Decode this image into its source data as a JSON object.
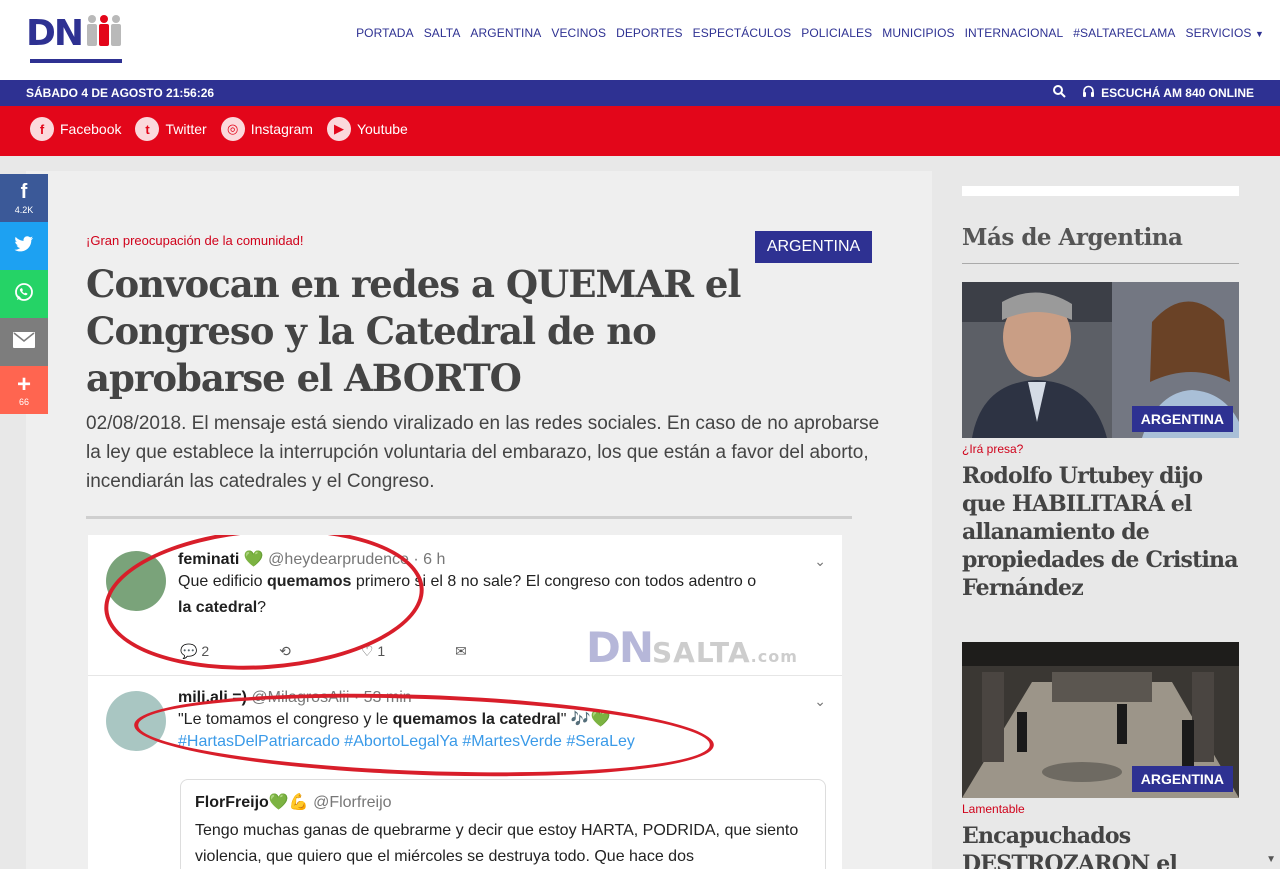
{
  "header": {
    "logo_text": "DN",
    "nav": [
      "PORTADA",
      "SALTA",
      "ARGENTINA",
      "VECINOS",
      "DEPORTES",
      "ESPECTÁCULOS",
      "POLICIALES",
      "MUNICIPIOS",
      "INTERNACIONAL",
      "#SALTARECLAMA",
      "SERVICIOS"
    ],
    "date": "SÁBADO 4 DE AGOSTO 21:56:26",
    "radio": "ESCUCHÁ AM 840 ONLINE"
  },
  "socials": [
    {
      "label": "Facebook",
      "icon": "facebook-icon",
      "glyph": "f"
    },
    {
      "label": "Twitter",
      "icon": "twitter-icon",
      "glyph": "t"
    },
    {
      "label": "Instagram",
      "icon": "instagram-icon",
      "glyph": "◎"
    },
    {
      "label": "Youtube",
      "icon": "youtube-icon",
      "glyph": "▶"
    }
  ],
  "share": [
    {
      "icon": "facebook-icon",
      "glyph": "f",
      "count": "4.2K",
      "color": "#3b5998"
    },
    {
      "icon": "twitter-icon",
      "glyph": "🐦",
      "count": "",
      "color": "#1da1f2"
    },
    {
      "icon": "whatsapp-icon",
      "glyph": "☏",
      "count": "",
      "color": "#25d366"
    },
    {
      "icon": "email-icon",
      "glyph": "✉",
      "count": "",
      "color": "#7d7d7d"
    },
    {
      "icon": "plus-icon",
      "glyph": "+",
      "count": "66",
      "color": "#ff6550"
    }
  ],
  "article": {
    "kicker": "¡Gran preocupación de la comunidad!",
    "category": "ARGENTINA",
    "headline": "Convocan en redes a QUEMAR el Congreso y la Catedral de no aprobarse el ABORTO",
    "lead": "02/08/2018. El mensaje está siendo viralizado en las redes sociales. En caso de no aprobarse la ley que establece la interrupción voluntaria del embarazo, los que están a favor del aborto, incendiarán las catedrales y el Congreso."
  },
  "tweets": {
    "t1_name": "feminati 💚",
    "t1_handle": "@heydearprudence · 6 h",
    "t1_text_a": "Que edificio ",
    "t1_text_b": "quemamos",
    "t1_text_c": " primero si el 8 no sale? El congreso con todos adentro o",
    "t1_text_d": "la catedral",
    "t1_text_e": "?",
    "t1_replies": "2",
    "t1_likes": "1",
    "t2_name": "mili.ali =)",
    "t2_handle": "@MilagrosAlii · 53 min",
    "t2_text_a": "\"Le tomamos el congreso y le ",
    "t2_text_b": "quemamos la catedral",
    "t2_text_c": "\" 🎶💚",
    "t2_hashtags": "#HartasDelPatriarcado #AbortoLegalYa #MartesVerde #SeraLey",
    "q_name": "FlorFreijo💚💪",
    "q_handle": "@Florfreijo",
    "q_text": "Tengo muchas ganas de quebrarme y decir que estoy HARTA, PODRIDA, que siento violencia, que quiero que el miércoles se destruya todo. Que hace dos",
    "watermark_a": "DN",
    "watermark_b": "SALTA",
    "watermark_c": ".com"
  },
  "sidebar": {
    "title": "Más de Argentina",
    "cards": [
      {
        "badge": "ARGENTINA",
        "kicker": "¿Irá presa?",
        "title": "Rodolfo Urtubey dijo que HABILITARÁ el allanamiento de propiedades de Cristina Fernández"
      },
      {
        "badge": "ARGENTINA",
        "kicker": "Lamentable",
        "title": "Encapuchados DESTROZARON el TEATRO"
      }
    ]
  }
}
